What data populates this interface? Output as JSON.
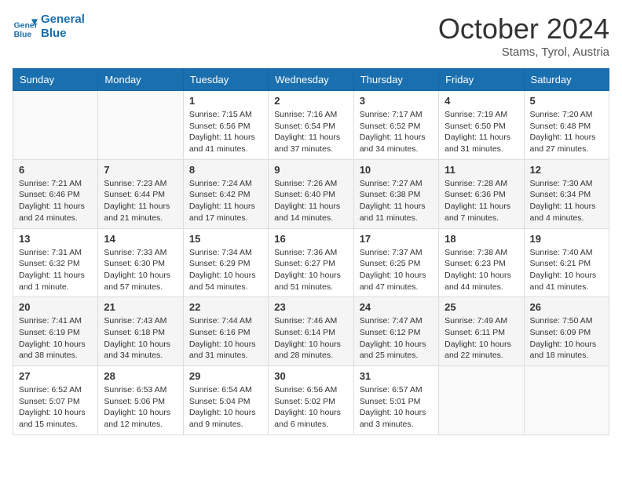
{
  "logo": {
    "line1": "General",
    "line2": "Blue"
  },
  "title": "October 2024",
  "location": "Stams, Tyrol, Austria",
  "days_of_week": [
    "Sunday",
    "Monday",
    "Tuesday",
    "Wednesday",
    "Thursday",
    "Friday",
    "Saturday"
  ],
  "weeks": [
    [
      {
        "day": "",
        "info": ""
      },
      {
        "day": "",
        "info": ""
      },
      {
        "day": "1",
        "info": "Sunrise: 7:15 AM\nSunset: 6:56 PM\nDaylight: 11 hours and 41 minutes."
      },
      {
        "day": "2",
        "info": "Sunrise: 7:16 AM\nSunset: 6:54 PM\nDaylight: 11 hours and 37 minutes."
      },
      {
        "day": "3",
        "info": "Sunrise: 7:17 AM\nSunset: 6:52 PM\nDaylight: 11 hours and 34 minutes."
      },
      {
        "day": "4",
        "info": "Sunrise: 7:19 AM\nSunset: 6:50 PM\nDaylight: 11 hours and 31 minutes."
      },
      {
        "day": "5",
        "info": "Sunrise: 7:20 AM\nSunset: 6:48 PM\nDaylight: 11 hours and 27 minutes."
      }
    ],
    [
      {
        "day": "6",
        "info": "Sunrise: 7:21 AM\nSunset: 6:46 PM\nDaylight: 11 hours and 24 minutes."
      },
      {
        "day": "7",
        "info": "Sunrise: 7:23 AM\nSunset: 6:44 PM\nDaylight: 11 hours and 21 minutes."
      },
      {
        "day": "8",
        "info": "Sunrise: 7:24 AM\nSunset: 6:42 PM\nDaylight: 11 hours and 17 minutes."
      },
      {
        "day": "9",
        "info": "Sunrise: 7:26 AM\nSunset: 6:40 PM\nDaylight: 11 hours and 14 minutes."
      },
      {
        "day": "10",
        "info": "Sunrise: 7:27 AM\nSunset: 6:38 PM\nDaylight: 11 hours and 11 minutes."
      },
      {
        "day": "11",
        "info": "Sunrise: 7:28 AM\nSunset: 6:36 PM\nDaylight: 11 hours and 7 minutes."
      },
      {
        "day": "12",
        "info": "Sunrise: 7:30 AM\nSunset: 6:34 PM\nDaylight: 11 hours and 4 minutes."
      }
    ],
    [
      {
        "day": "13",
        "info": "Sunrise: 7:31 AM\nSunset: 6:32 PM\nDaylight: 11 hours and 1 minute."
      },
      {
        "day": "14",
        "info": "Sunrise: 7:33 AM\nSunset: 6:30 PM\nDaylight: 10 hours and 57 minutes."
      },
      {
        "day": "15",
        "info": "Sunrise: 7:34 AM\nSunset: 6:29 PM\nDaylight: 10 hours and 54 minutes."
      },
      {
        "day": "16",
        "info": "Sunrise: 7:36 AM\nSunset: 6:27 PM\nDaylight: 10 hours and 51 minutes."
      },
      {
        "day": "17",
        "info": "Sunrise: 7:37 AM\nSunset: 6:25 PM\nDaylight: 10 hours and 47 minutes."
      },
      {
        "day": "18",
        "info": "Sunrise: 7:38 AM\nSunset: 6:23 PM\nDaylight: 10 hours and 44 minutes."
      },
      {
        "day": "19",
        "info": "Sunrise: 7:40 AM\nSunset: 6:21 PM\nDaylight: 10 hours and 41 minutes."
      }
    ],
    [
      {
        "day": "20",
        "info": "Sunrise: 7:41 AM\nSunset: 6:19 PM\nDaylight: 10 hours and 38 minutes."
      },
      {
        "day": "21",
        "info": "Sunrise: 7:43 AM\nSunset: 6:18 PM\nDaylight: 10 hours and 34 minutes."
      },
      {
        "day": "22",
        "info": "Sunrise: 7:44 AM\nSunset: 6:16 PM\nDaylight: 10 hours and 31 minutes."
      },
      {
        "day": "23",
        "info": "Sunrise: 7:46 AM\nSunset: 6:14 PM\nDaylight: 10 hours and 28 minutes."
      },
      {
        "day": "24",
        "info": "Sunrise: 7:47 AM\nSunset: 6:12 PM\nDaylight: 10 hours and 25 minutes."
      },
      {
        "day": "25",
        "info": "Sunrise: 7:49 AM\nSunset: 6:11 PM\nDaylight: 10 hours and 22 minutes."
      },
      {
        "day": "26",
        "info": "Sunrise: 7:50 AM\nSunset: 6:09 PM\nDaylight: 10 hours and 18 minutes."
      }
    ],
    [
      {
        "day": "27",
        "info": "Sunrise: 6:52 AM\nSunset: 5:07 PM\nDaylight: 10 hours and 15 minutes."
      },
      {
        "day": "28",
        "info": "Sunrise: 6:53 AM\nSunset: 5:06 PM\nDaylight: 10 hours and 12 minutes."
      },
      {
        "day": "29",
        "info": "Sunrise: 6:54 AM\nSunset: 5:04 PM\nDaylight: 10 hours and 9 minutes."
      },
      {
        "day": "30",
        "info": "Sunrise: 6:56 AM\nSunset: 5:02 PM\nDaylight: 10 hours and 6 minutes."
      },
      {
        "day": "31",
        "info": "Sunrise: 6:57 AM\nSunset: 5:01 PM\nDaylight: 10 hours and 3 minutes."
      },
      {
        "day": "",
        "info": ""
      },
      {
        "day": "",
        "info": ""
      }
    ]
  ]
}
